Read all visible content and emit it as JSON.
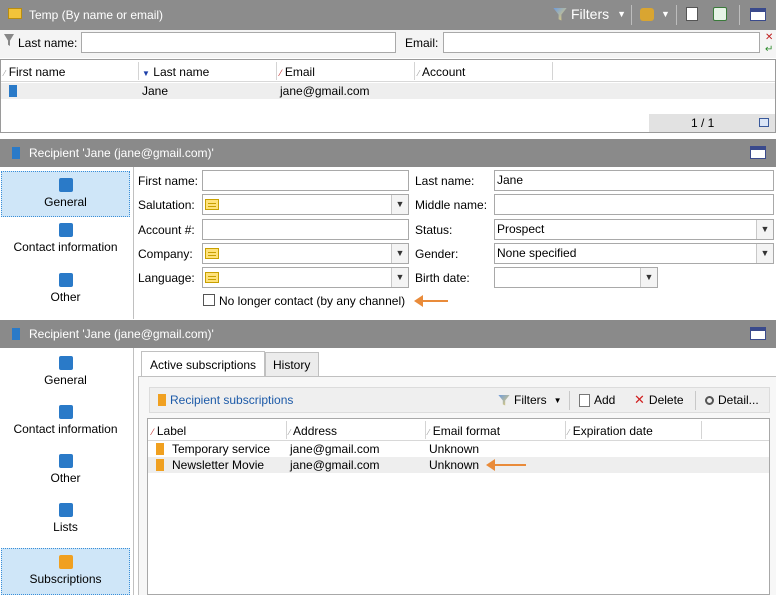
{
  "colors": {
    "header_bg": "#8a8a8a",
    "selection_bg": "#cfe6f8",
    "row_bg": "#eeeeee",
    "accent_blue": "#2a7ac8",
    "arrow": "#e98b3a",
    "link": "#1c5aa8"
  },
  "top": {
    "title": "Temp (By name or email)",
    "filters_label": "Filters",
    "search": {
      "last_name_label": "Last name:",
      "last_name_value": "",
      "email_label": "Email:",
      "email_value": ""
    },
    "columns": [
      "First name",
      "Last name",
      "Email",
      "Account"
    ],
    "rows": [
      {
        "first_name": "",
        "last_name": "Jane",
        "email": "jane@gmail.com",
        "account": ""
      }
    ],
    "pager": "1 / 1"
  },
  "recipient1": {
    "title": "Recipient 'Jane  (jane@gmail.com)'",
    "sidebar": [
      "General",
      "Contact information",
      "Other"
    ],
    "form": {
      "first_name_label": "First name:",
      "first_name_value": "",
      "last_name_label": "Last name:",
      "last_name_value": "Jane",
      "salutation_label": "Salutation:",
      "salutation_value": "",
      "middle_name_label": "Middle name:",
      "middle_name_value": "",
      "account_label": "Account #:",
      "account_value": "",
      "status_label": "Status:",
      "status_value": "Prospect",
      "company_label": "Company:",
      "company_value": "",
      "gender_label": "Gender:",
      "gender_value": "None specified",
      "language_label": "Language:",
      "language_value": "",
      "birth_label": "Birth date:",
      "birth_value": "",
      "no_contact_label": "No longer contact (by any channel)"
    }
  },
  "recipient2": {
    "title": "Recipient 'Jane  (jane@gmail.com)'",
    "sidebar": [
      "General",
      "Contact information",
      "Other",
      "Lists",
      "Subscriptions"
    ],
    "tabs": [
      "Active subscriptions",
      "History"
    ],
    "toolbar": {
      "title": "Recipient subscriptions",
      "filters": "Filters",
      "add": "Add",
      "delete": "Delete",
      "detail": "Detail..."
    },
    "columns": [
      "Label",
      "Address",
      "Email format",
      "Expiration date"
    ],
    "rows": [
      {
        "label": "Temporary service",
        "address": "jane@gmail.com",
        "format": "Unknown",
        "expiration": ""
      },
      {
        "label": "Newsletter Movie",
        "address": "jane@gmail.com",
        "format": "Unknown",
        "expiration": ""
      }
    ]
  }
}
